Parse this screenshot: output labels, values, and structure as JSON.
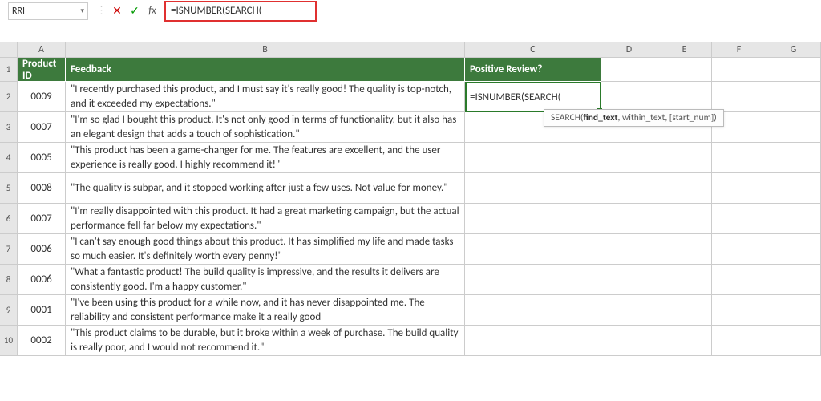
{
  "nameBox": "RRI",
  "formula": "=ISNUMBER(SEARCH(",
  "columns": [
    "",
    "A",
    "B",
    "C",
    "D",
    "E",
    "F",
    "G"
  ],
  "headers": {
    "a": "Product ID",
    "b": "Feedback",
    "c": "Positive Review?"
  },
  "rows": [
    {
      "n": "1"
    },
    {
      "n": "2",
      "id": "0009",
      "fb": "\"I recently purchased this product, and I must say it's really good! The quality is top-notch, and it exceeded my expectations.\"",
      "c": "=ISNUMBER(SEARCH("
    },
    {
      "n": "3",
      "id": "0007",
      "fb": "\"I'm so glad I bought this product. It's not only good in terms of functionality, but it also has an elegant design that adds a touch of sophistication.\""
    },
    {
      "n": "4",
      "id": "0005",
      "fb": "\"This product has been a game-changer for me. The features are excellent, and the user experience is really good. I highly recommend it!\""
    },
    {
      "n": "5",
      "id": "0008",
      "fb": "\"The quality is subpar, and it stopped working after just a few uses. Not value for money.\""
    },
    {
      "n": "6",
      "id": "0007",
      "fb": "\"I'm really disappointed with this product. It had a great marketing campaign, but the actual performance fell far below my expectations.\""
    },
    {
      "n": "7",
      "id": "0006",
      "fb": "\"I can't say enough good things about this product. It has simplified my life and made tasks so much easier. It's definitely worth every penny!\""
    },
    {
      "n": "8",
      "id": "0006",
      "fb": "\"What a fantastic product! The build quality is impressive, and the results it delivers are consistently good. I'm a happy customer.\""
    },
    {
      "n": "9",
      "id": "0001",
      "fb": "\"I've been using this product for a while now, and it has never disappointed me. The reliability and consistent performance make it a really good"
    },
    {
      "n": "10",
      "id": "0002",
      "fb": "\"This product claims to be durable, but it broke within a week of purchase. The build quality is really poor, and I would not recommend it.\""
    }
  ],
  "tooltip": {
    "fn": "SEARCH",
    "arg1": "find_text",
    "rest": ", within_text, [start_num])"
  }
}
